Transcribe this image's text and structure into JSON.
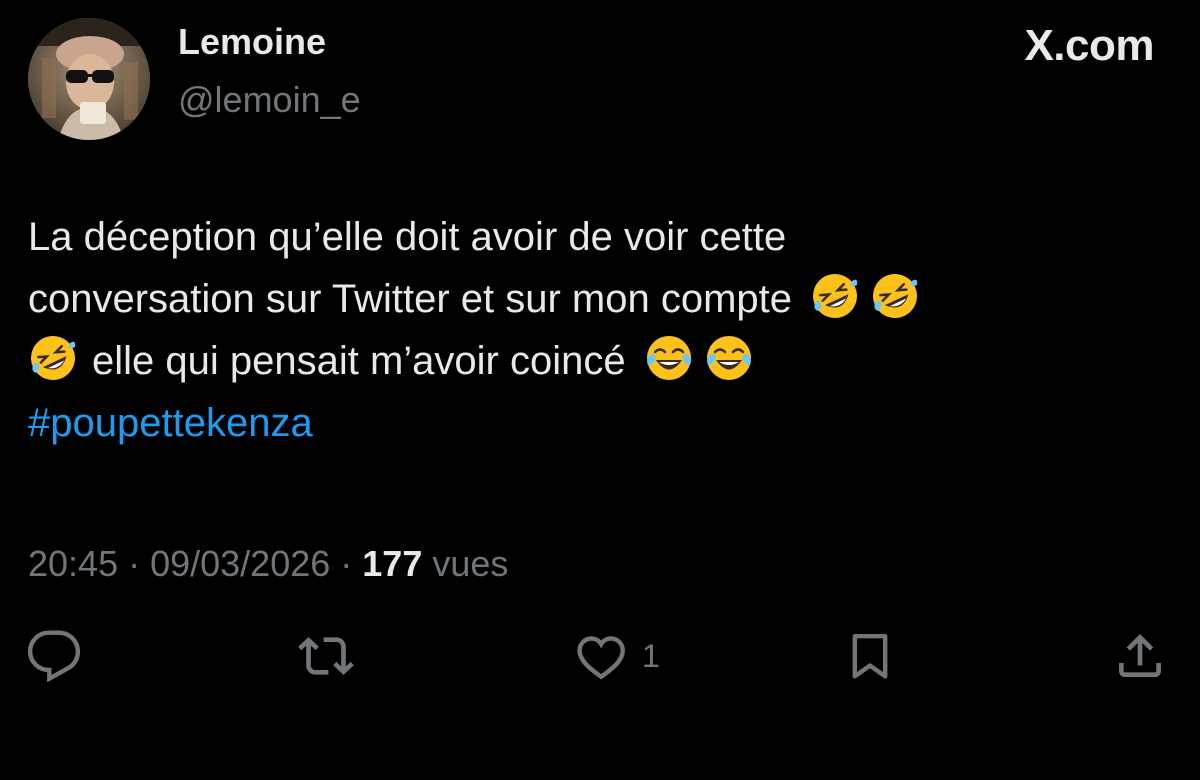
{
  "header": {
    "display_name": "Lemoine",
    "handle": "@lemoin_e",
    "avatar_icon": "profile-photo-person-sunglasses",
    "watermark": "X.com"
  },
  "tweet": {
    "lines": [
      "La déception qu’elle doit avoir de voir cette",
      "conversation sur Twitter et sur mon compte",
      "elle qui pensait m’avoir coincé"
    ],
    "hashtag": "#poupettekenza",
    "emoji": [
      "rolling-on-floor-laughing",
      "rolling-on-floor-laughing",
      "rolling-on-floor-laughing",
      "face-with-tears-of-joy",
      "face-with-tears-of-joy"
    ]
  },
  "meta": {
    "time": "20:45",
    "sep1": " · ",
    "date": "09/03/2026",
    "sep2": " · ",
    "views_count": "177",
    "views_label": " vues"
  },
  "actions": {
    "reply_icon": "reply-icon",
    "repost_icon": "repost-icon",
    "like_icon": "heart-icon",
    "like_count": "1",
    "bookmark_icon": "bookmark-icon",
    "share_icon": "share-icon"
  },
  "colors": {
    "background": "#000000",
    "text": "#e7e9ea",
    "secondary": "#71767b",
    "link": "#1d9bf0"
  }
}
